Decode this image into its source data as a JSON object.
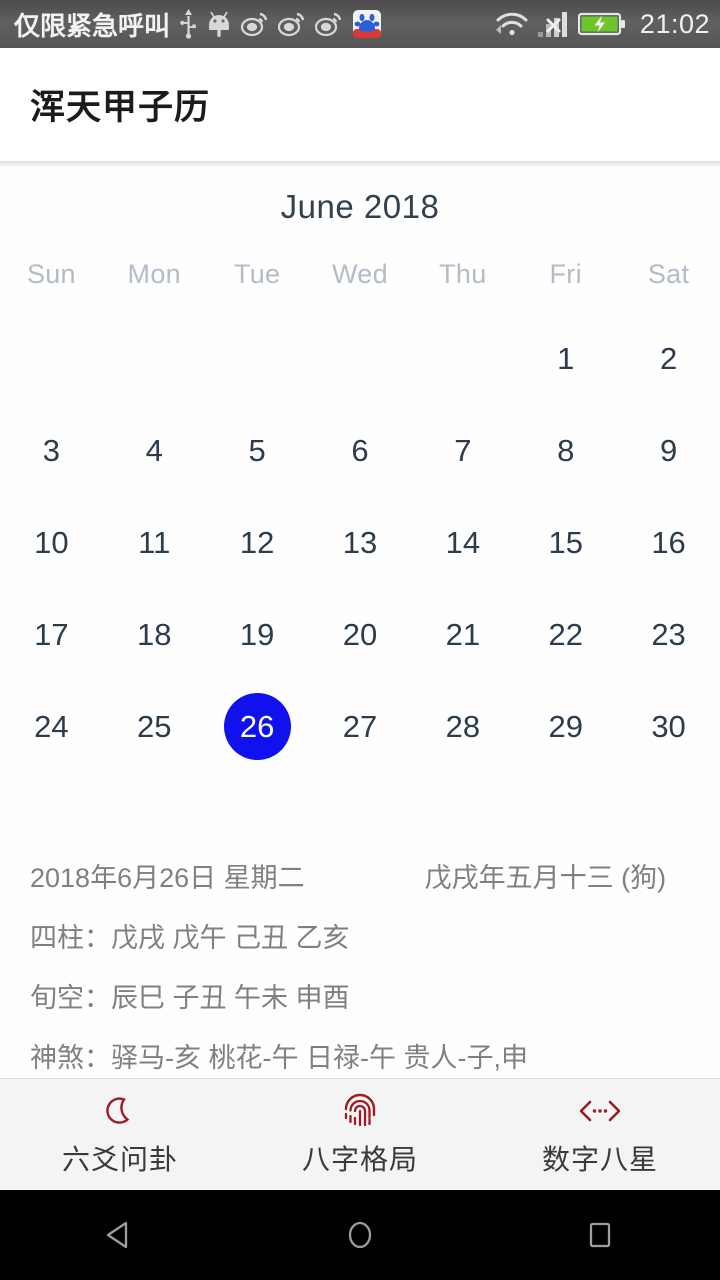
{
  "status_bar": {
    "carrier": "仅限紧急呼叫",
    "time": "21:02",
    "icons": [
      "usb-icon",
      "android-icon",
      "weibo-icon",
      "weibo-icon",
      "weibo-icon",
      "baidu-cloud-icon",
      "wifi-icon",
      "signal-no-service-icon",
      "battery-charging-icon"
    ]
  },
  "app_bar": {
    "title": "浑天甲子历"
  },
  "calendar": {
    "month_label": "June 2018",
    "weekdays": [
      "Sun",
      "Mon",
      "Tue",
      "Wed",
      "Thu",
      "Fri",
      "Sat"
    ],
    "leading_blanks": 5,
    "days": [
      1,
      2,
      3,
      4,
      5,
      6,
      7,
      8,
      9,
      10,
      11,
      12,
      13,
      14,
      15,
      16,
      17,
      18,
      19,
      20,
      21,
      22,
      23,
      24,
      25,
      26,
      27,
      28,
      29,
      30
    ],
    "selected_day": 26,
    "selected_color": "#1111ee",
    "day_text_color": "#2d3c4d",
    "weekday_text_color": "#b3bcc8"
  },
  "details": {
    "solar_date": "2018年6月26日 星期二",
    "lunar_date": "戊戌年五月十三 (狗)",
    "four_pillars": "四柱：戊戌 戊午 己丑 乙亥",
    "void_periods": "旬空：辰巳 子丑 午未 申酉",
    "deities": "神煞：驿马-亥 桃花-午 日禄-午 贵人-子,申"
  },
  "tabs": [
    {
      "label": "六爻问卦",
      "icon": "crescent-moon-icon",
      "color": "#9e1b21"
    },
    {
      "label": "八字格局",
      "icon": "fingerprint-icon",
      "color": "#9e1b21"
    },
    {
      "label": "数字八星",
      "icon": "code-brackets-icon",
      "color": "#9e1b21"
    }
  ],
  "nav_bar": {
    "back": "back-triangle-icon",
    "home": "home-circle-icon",
    "recents": "recents-square-icon"
  }
}
